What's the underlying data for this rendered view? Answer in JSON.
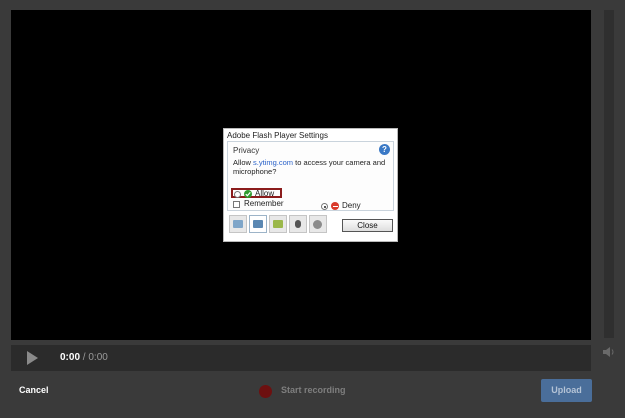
{
  "player": {
    "current_time": "0:00",
    "separator": "/",
    "total_time": "0:00"
  },
  "flash_dialog": {
    "title": "Adobe Flash Player Settings",
    "panel_heading": "Privacy",
    "help_glyph": "?",
    "text_prefix": "Allow ",
    "domain": "s.ytimg.com",
    "text_suffix": " to access your camera and microphone?",
    "allow_label": "Allow",
    "deny_label": "Deny",
    "selected_option": "Deny",
    "remember_label": "Remember",
    "remember_checked": false,
    "close_label": "Close",
    "tabs": [
      {
        "icon": "display-icon",
        "active": false
      },
      {
        "icon": "privacy-icon",
        "active": true
      },
      {
        "icon": "storage-icon",
        "active": false
      },
      {
        "icon": "microphone-icon",
        "active": false
      },
      {
        "icon": "camera-icon",
        "active": false
      }
    ]
  },
  "bottom_bar": {
    "cancel_label": "Cancel",
    "record_label": "Start recording",
    "upload_label": "Upload"
  },
  "colors": {
    "background": "#3a3a3a",
    "video": "#000000",
    "upload_button": "#4a6e9a",
    "record_dot": "#6d1010",
    "allow_highlight": "#8b1c1c"
  }
}
